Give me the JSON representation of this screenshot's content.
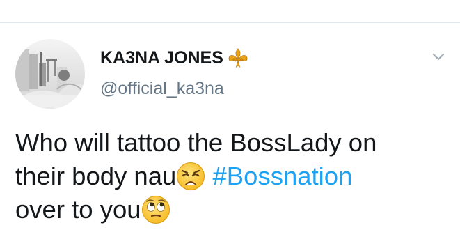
{
  "tweet": {
    "author": {
      "display_name": "KA3NA JONES",
      "handle": "@official_ka3na",
      "badge_icon": "fleur-de-lis-icon",
      "badge_color": "#e8a317"
    },
    "menu_icon": "chevron-down-icon",
    "text": {
      "line1": "Who will tattoo the BossLady on",
      "line2_prefix": "their body nau",
      "line2_emoji": "weary-face-emoji",
      "line2_hashtag": "#Bossnation",
      "line3_prefix": "over to you",
      "line3_emoji": "rolling-eyes-emoji"
    }
  },
  "colors": {
    "text": "#14171a",
    "secondary": "#657786",
    "link": "#1da1f2",
    "divider": "#e1e8ed"
  }
}
